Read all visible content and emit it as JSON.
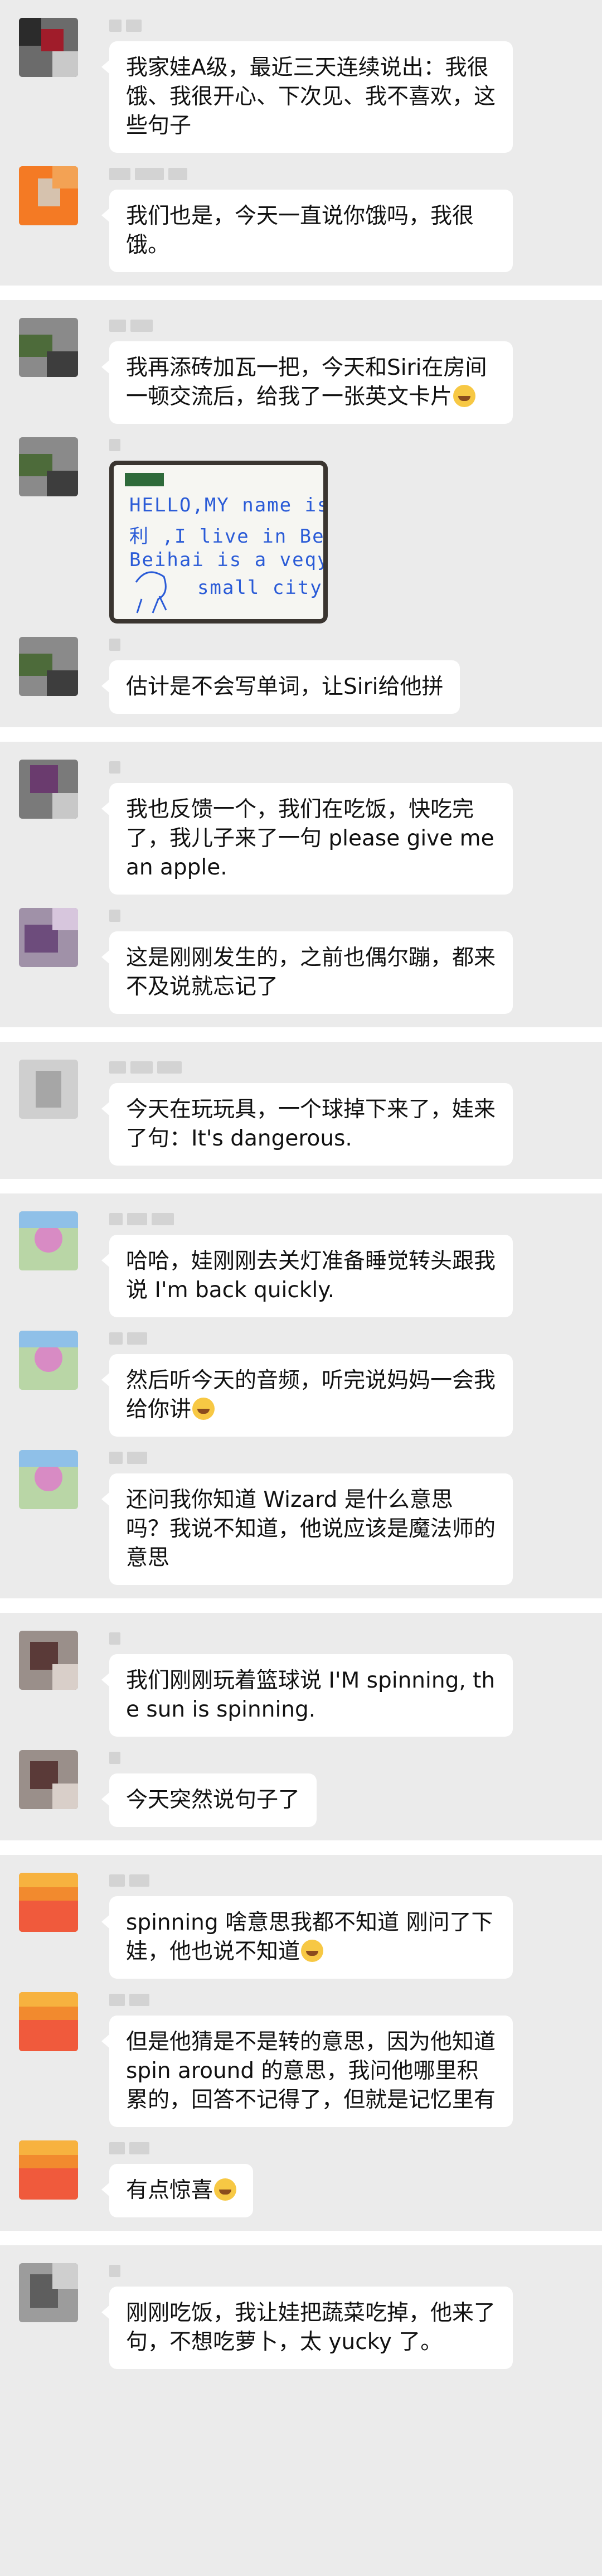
{
  "messages": [
    {
      "text": "我家娃A级，最近三天连续说出：我很饿、我很开心、下次见、我不喜欢，这些句子"
    },
    {
      "text": "我们也是，今天一直说你饿吗，我很饿。"
    },
    {
      "text": "我再添砖加瓦一把，今天和Siri在房间一顿交流后，给我了一张英文卡片"
    },
    {
      "image_card": {
        "line1": "HELLO,MY name is",
        "line2": "利  ,I live in Beihai.",
        "line3": "Beihai is a veqy",
        "line4": "small city"
      }
    },
    {
      "text": "估计是不会写单词，让Siri给他拼"
    },
    {
      "text": "我也反馈一个，我们在吃饭，快吃完了，我儿子来了一句 please give me an apple."
    },
    {
      "text": "这是刚刚发生的，之前也偶尔蹦，都来不及说就忘记了"
    },
    {
      "text": "今天在玩玩具，一个球掉下来了，娃来了句：It's dangerous."
    },
    {
      "text": "哈哈，娃刚刚去关灯准备睡觉转头跟我说 I'm back quickly."
    },
    {
      "text": "然后听今天的音频，听完说妈妈一会我给你讲"
    },
    {
      "text": "还问我你知道 Wizard 是什么意思吗？我说不知道，他说应该是魔法师的意思"
    },
    {
      "text": "我们刚刚玩着篮球说 I'M spinning, the sun is spinning."
    },
    {
      "text": "今天突然说句子了"
    },
    {
      "text": "spinning 啥意思我都不知道 刚问了下娃，他也说不知道"
    },
    {
      "text": "但是他猜是不是转的意思，因为他知道 spin around 的意思，我问他哪里积累的，回答不记得了，但就是记忆里有"
    },
    {
      "text": "有点惊喜"
    },
    {
      "text": "刚刚吃饭，我让娃把蔬菜吃掉，他来了句，不想吃萝卜，太 yucky 了。"
    }
  ]
}
